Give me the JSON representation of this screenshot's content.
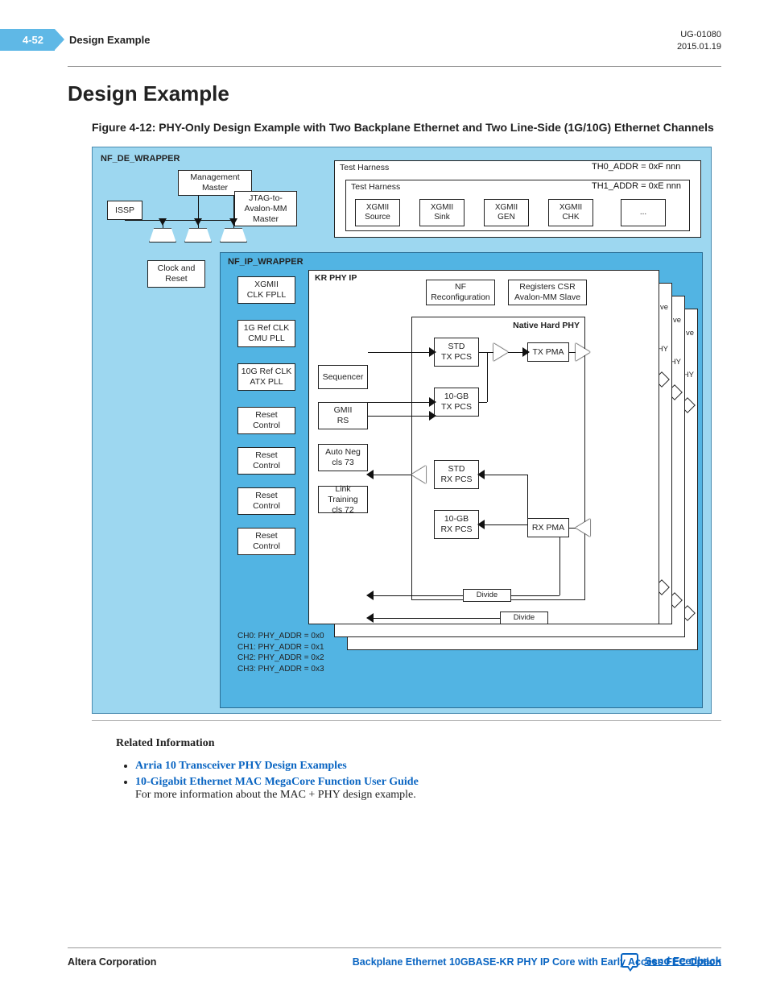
{
  "header": {
    "page_number": "4-52",
    "section_title": "Design Example",
    "doc_id": "UG-01080",
    "doc_date": "2015.01.19"
  },
  "main": {
    "heading": "Design Example",
    "figure_caption": "Figure 4-12: PHY-Only Design Example with Two Backplane Ethernet and Two Line-Side (1G/10G) Ethernet Channels"
  },
  "diagram": {
    "outer_label": "NF_DE_WRAPPER",
    "management_master": "Management\nMaster",
    "issp": "ISSP",
    "jtag": "JTAG-to-\nAvalon-MM\nMaster",
    "clock_reset": "Clock and\nReset",
    "test_harness_1": "Test Harness",
    "test_harness_2": "Test Harness",
    "th0": "TH0_ADDR = 0xF   nnn",
    "th1": "TH1_ADDR = 0xE   nnn",
    "xgmii_source": "XGMII\nSource",
    "xgmii_sink": "XGMII\nSink",
    "xgmii_gen": "XGMII\nGEN",
    "xgmii_chk": "XGMII\nCHK",
    "ellipsis": "...",
    "ip_label": "NF_IP_WRAPPER",
    "xgmii_clk": "XGMII\nCLK FPLL",
    "ref1g": "1G Ref CLK\nCMU PLL",
    "ref10g": "10G Ref CLK\nATX PLL",
    "reset_control": "Reset\nControl",
    "kr_label": "KR PHY IP",
    "sequencer": "Sequencer",
    "gmii_rs": "GMII\nRS",
    "autoneg": "Auto Neg\ncls 73",
    "linktrain": "Link Training\ncls 72",
    "nf_reconfig": "NF\nReconfiguration",
    "registers": "Registers CSR\nAvalon-MM Slave",
    "native_phy": "Native Hard PHY",
    "std_tx_pcs": "STD\nTX PCS",
    "gb10_tx_pcs": "10-GB\nTX PCS",
    "std_rx_pcs": "STD\nRX PCS",
    "gb10_rx_pcs": "10-GB\nRX PCS",
    "tx_pma": "TX PMA",
    "rx_pma": "RX PMA",
    "divide": "Divide",
    "addrs": {
      "ch0": "CH0: PHY_ADDR = 0x0",
      "ch1": "CH1: PHY_ADDR = 0x1",
      "ch2": "CH2: PHY_ADDR = 0x2",
      "ch3": "CH3: PHY_ADDR = 0x3"
    },
    "ghost_ve": "ve",
    "ghost_hy": "HY"
  },
  "related": {
    "heading": "Related Information",
    "link1": "Arria 10 Transceiver PHY Design Examples",
    "link2": "10-Gigabit Ethernet MAC MegaCore Function User Guide",
    "link2_desc": "For more information about the MAC + PHY design example."
  },
  "footer": {
    "left": "Altera Corporation",
    "right": "Backplane Ethernet 10GBASE-KR PHY IP Core with Early Access FEC Option",
    "feedback": "Send Feedback"
  }
}
